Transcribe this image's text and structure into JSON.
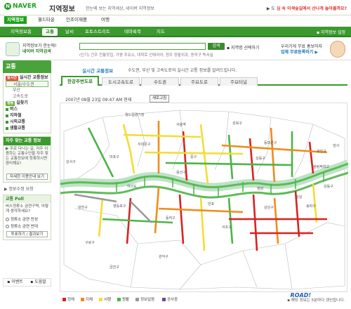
{
  "header": {
    "logo": "NAVER",
    "service": "지역정보",
    "tagline": "한눈에 보는 지역세상, 네이버 지역정보",
    "right_prefix": "▶ 도 ",
    "right_highlight": "심 속 이색숲길에서 산나게 놀아볼까요?"
  },
  "top_nav": [
    "지역정보",
    "월드타운",
    "인조이재팬",
    "여행"
  ],
  "green_nav": {
    "items": [
      "지역정보홈",
      "교통",
      "날씨",
      "포토스트리트",
      "테마룩북",
      "지도"
    ],
    "my_service": "▪ 지역정보 설정"
  },
  "search": {
    "banner_line1": "지역정보가 한눈에!",
    "banner_line2": "네이버 지역검색",
    "button": "검색",
    "region_label": "▪ 지역명 선택하기",
    "hint": "(인기) 건주 전통찻집, 가평 주유소, 대학로 인테리어, 청주 장밭외과, 동작구 독서실",
    "ad_line1": "우리가게 무료 홍보하자",
    "ad_line2": "업체 무료등록하기 ▶"
  },
  "left": {
    "section_title": "교통",
    "box1_title": "실시간 교통정보",
    "box1_sub": [
      "서울/수도권",
      "부산",
      "고속도로"
    ],
    "box1_badge": "실시간",
    "items": [
      {
        "badge": "행동",
        "label": "길찾기"
      },
      {
        "badge": "",
        "label": "버스"
      },
      {
        "badge": "",
        "label": "지하철"
      },
      {
        "badge": "",
        "label": "시외교통"
      },
      {
        "badge": "",
        "label": "생활교통"
      }
    ],
    "faq_title": "자주 찾는 교통 정보",
    "faq_body": "▶ 주로 다니는 길, 자주 이용하는 교통수단을 자주 찾는 교통정보에 등록하시면 편리해요!",
    "faq_button": "자세한 이용안내 보기",
    "faq_link": "▶ 정보수정 요청",
    "poll_title": "교통 Poll",
    "poll_question": "버스정류소 금연구역, 어떻게 생각하세요?",
    "poll_options": [
      "정류소 금연 찬성",
      "정류소 금연 반대"
    ],
    "poll_button": "투표하기 / 결과보기",
    "footer": [
      "이벤트",
      "도움말"
    ]
  },
  "main": {
    "title": "실시간 교통정보",
    "desc": "수도권, 부산 및 고속도로의 실시간 교통 정보를 알려드립니다.",
    "tabs": [
      "한강주변도로",
      "도시고속도로",
      "수도권",
      "주요도로",
      "주요터널"
    ],
    "timestamp": "2007년 08월 23일 09:47 AM 현재",
    "refresh": "새로고침",
    "legend": [
      {
        "label": "정체",
        "color": "#d8231f"
      },
      {
        "label": "지체",
        "color": "#f08c1c"
      },
      {
        "label": "서행",
        "color": "#f2dd35"
      },
      {
        "label": "원활",
        "color": "#4bb546"
      },
      {
        "label": "정보없음",
        "color": "#999999"
      },
      {
        "label": "공사중",
        "color": "#6a4b9b"
      }
    ],
    "note": "▪ 해당 정보는 5분마다 갱신됩니다.",
    "brand": "ROAD!",
    "map_labels": [
      "월드컵경기장",
      "서울역",
      "서대문구",
      "성북구",
      "동대문구",
      "광진구",
      "중구",
      "성동구",
      "용산구",
      "강서구",
      "양천구",
      "영등포구",
      "마포구",
      "동작구",
      "서초구",
      "강남구",
      "송파구",
      "강동구",
      "구로구",
      "금천구",
      "관악구",
      "반포",
      "잠실",
      "여의도",
      "청담",
      "올림픽대교",
      "암사"
    ]
  }
}
